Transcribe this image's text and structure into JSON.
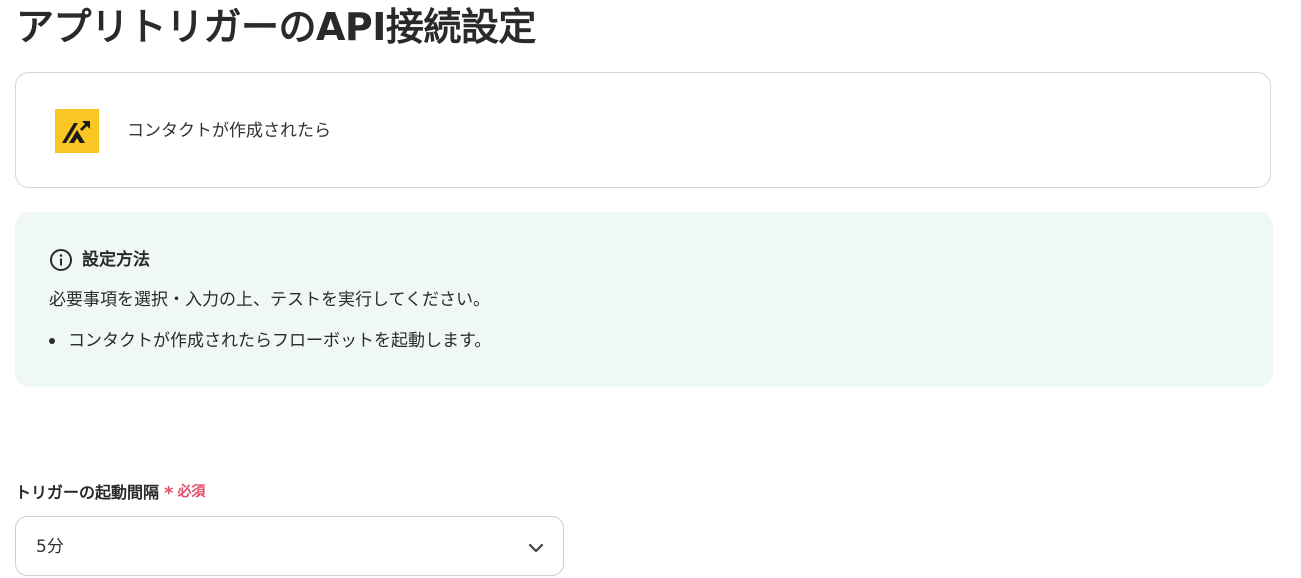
{
  "page": {
    "title": "アプリトリガーのAPI接続設定"
  },
  "trigger": {
    "app_icon": "app-logo-icon",
    "label": "コンタクトが作成されたら"
  },
  "info": {
    "icon": "info-icon",
    "title": "設定方法",
    "body": "必要事項を選択・入力の上、テストを実行してください。",
    "bullets": [
      "コンタクトが作成されたらフローボットを起動します。"
    ]
  },
  "interval_field": {
    "label": "トリガーの起動間隔",
    "required_mark": "*",
    "required_text": "必須",
    "selected_value": "5分",
    "chevron_icon": "chevron-down-icon"
  },
  "colors": {
    "brand_logo": "#f9c623",
    "info_bg": "#eff8f7",
    "required": "#e2506a",
    "border": "#d6d6d6"
  }
}
